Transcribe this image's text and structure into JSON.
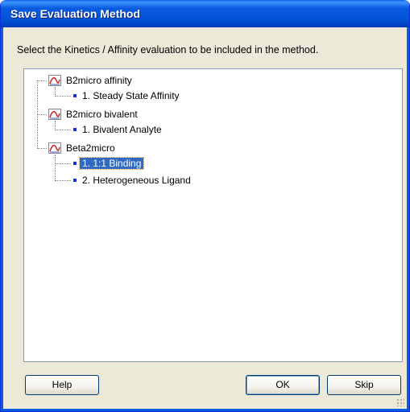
{
  "window": {
    "title": "Save Evaluation Method"
  },
  "instruction": "Select the Kinetics / Affinity evaluation to be included in the method.",
  "tree": {
    "groups": [
      {
        "label": "B2micro affinity",
        "icon": "evaluation-icon",
        "children": [
          {
            "label": "1.  Steady State Affinity",
            "selected": false
          }
        ]
      },
      {
        "label": "B2micro bivalent",
        "icon": "evaluation-icon",
        "children": [
          {
            "label": "1.  Bivalent Analyte",
            "selected": false
          }
        ]
      },
      {
        "label": "Beta2micro",
        "icon": "evaluation-icon",
        "children": [
          {
            "label": "1.  1:1 Binding",
            "selected": true
          },
          {
            "label": "2.  Heterogeneous Ligand",
            "selected": false
          }
        ]
      }
    ]
  },
  "buttons": {
    "help": "Help",
    "ok": "OK",
    "skip": "Skip"
  },
  "colors": {
    "titlebar": "#0a5ae0",
    "selection": "#316ac5",
    "bullet": "#1c2bd8",
    "dialog_bg": "#ece9d8"
  }
}
